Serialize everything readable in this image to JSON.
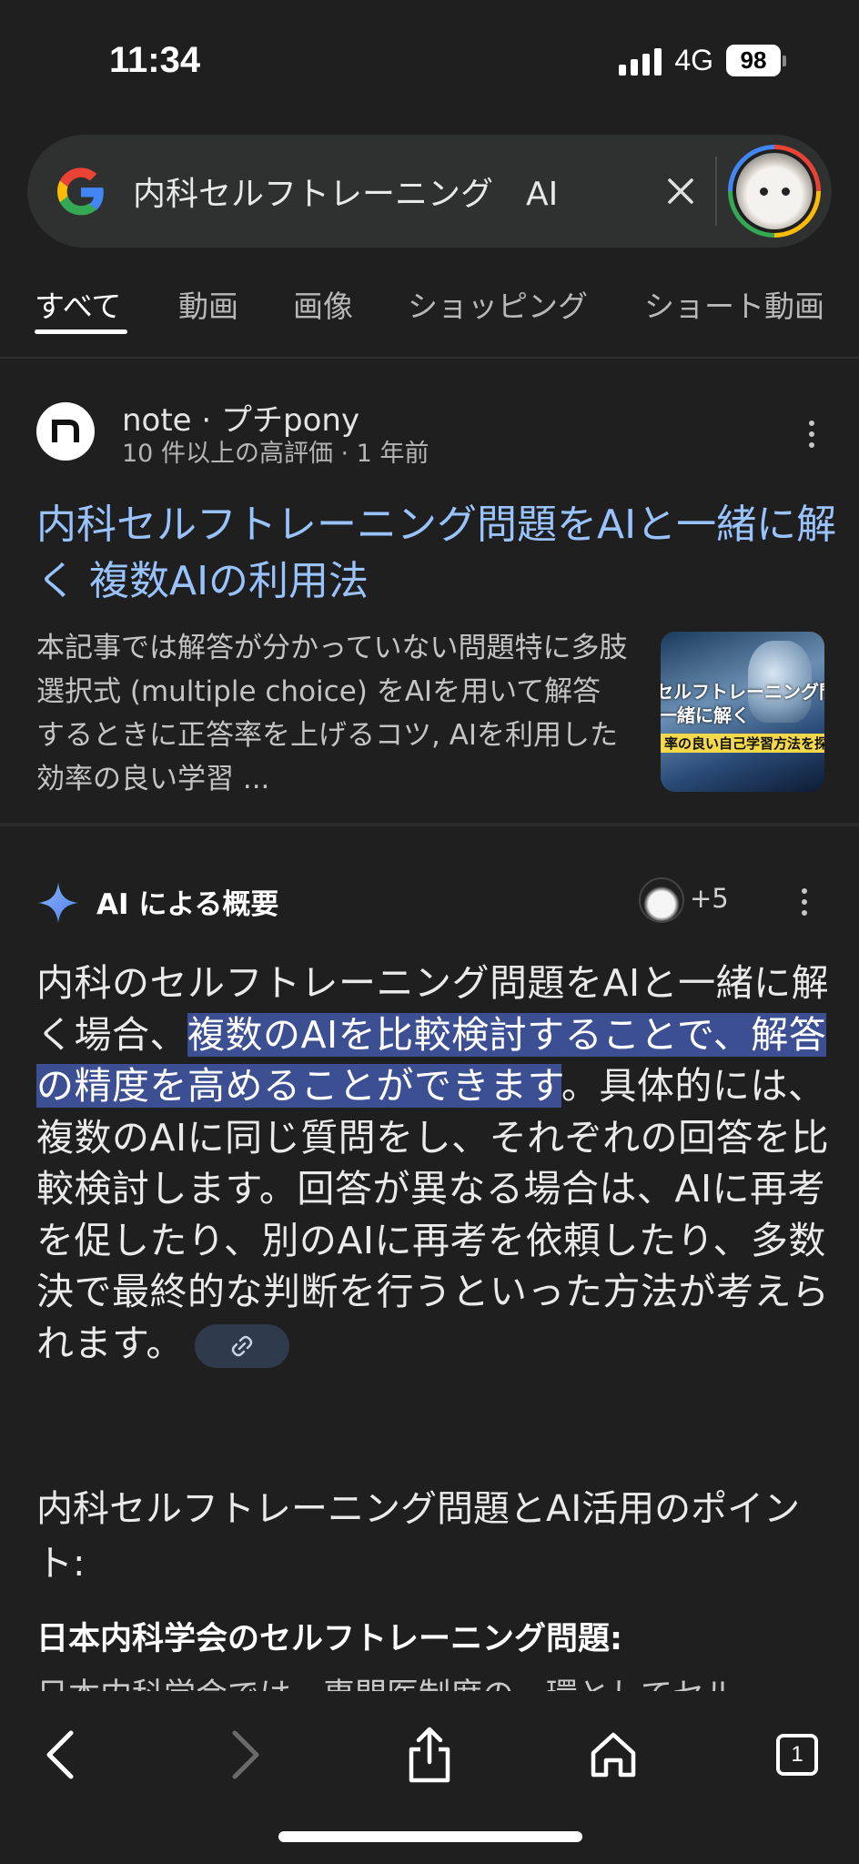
{
  "status_bar": {
    "time": "11:34",
    "network": "4G",
    "battery": "98"
  },
  "search": {
    "query": "内科セルフトレーニング　AI"
  },
  "tabs": [
    {
      "label": "すべて",
      "active": true
    },
    {
      "label": "動画",
      "active": false
    },
    {
      "label": "画像",
      "active": false
    },
    {
      "label": "ショッピング",
      "active": false
    },
    {
      "label": "ショート動画",
      "active": false
    }
  ],
  "result": {
    "site": "note · プチpony",
    "meta": "10 件以上の高評価 · 1 年前",
    "title": "内科セルフトレーニング問題をAIと一緒に解く 複数AIの利用法",
    "snippet": "本記事では解答が分かっていない問題特に多肢選択式 (multiple choice) をAIを用いて解答するときに正答率を上げるコツ, AIを利用した効率の良い学習 ...",
    "thumbnail": {
      "line1": "セルフトレーニング問",
      "line2": "一緒に解く",
      "line3": "率の良い自己学習方法を探る"
    }
  },
  "ai_overview": {
    "title": "AI による概要",
    "source_count": "+5",
    "body_before": "内科のセルフトレーニング問題をAIと一緒に解く場合、",
    "body_highlight": "複数のAIを比較検討することで、解答の精度を高めることができます",
    "body_after": "。具体的には、複数のAIに同じ質問をし、それぞれの回答を比較検討します。回答が異なる場合は、AIに再考を促したり、別のAIに再考を依頼したり、多数決で最終的な判断を行うといった方法が考えられます。",
    "subheading": "内科セルフトレーニング問題とAI活用のポイント:",
    "bold_heading": "日本内科学会のセルフトレーニング問題:",
    "next_line": "日本内科学会では、専門医制度の一環としてセル"
  },
  "toolbar": {
    "tab_count": "1"
  },
  "colors": {
    "background": "#1f1f1f",
    "link": "#99c3ff",
    "highlight": "#3c4f92",
    "search_bg": "#2f3030"
  }
}
